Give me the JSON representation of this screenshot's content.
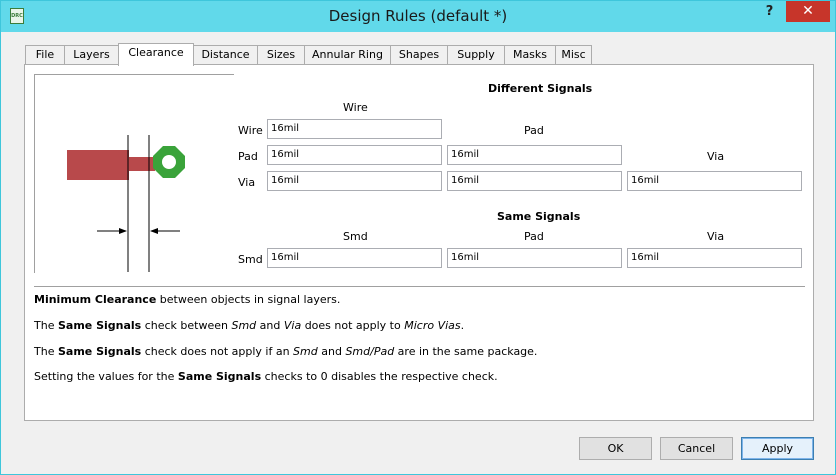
{
  "window": {
    "title": "Design Rules (default *)",
    "app_icon_text": "DRC",
    "help": "?",
    "close": "✕"
  },
  "tabs": [
    "File",
    "Layers",
    "Clearance",
    "Distance",
    "Sizes",
    "Annular Ring",
    "Shapes",
    "Supply",
    "Masks",
    "Misc"
  ],
  "active_tab": "Clearance",
  "colors": {
    "trace": "#b8494b",
    "via": "#3aa33a",
    "close": "#c7352a",
    "titlebar": "#61d9ea"
  },
  "different": {
    "heading": "Different Signals",
    "col_wire": "Wire",
    "col_pad": "Pad",
    "col_via": "Via",
    "row_wire": "Wire",
    "row_pad": "Pad",
    "row_via": "Via",
    "wire_wire": "16mil",
    "pad_wire": "16mil",
    "pad_pad": "16mil",
    "via_wire": "16mil",
    "via_pad": "16mil",
    "via_via": "16mil"
  },
  "same": {
    "heading": "Same Signals",
    "col_smd": "Smd",
    "col_pad": "Pad",
    "col_via": "Via",
    "row_smd": "Smd",
    "smd_smd": "16mil",
    "smd_pad": "16mil",
    "smd_via": "16mil"
  },
  "notes": {
    "n1_b": "Minimum Clearance",
    "n1_r": " between objects in signal layers.",
    "n2_a": "The ",
    "n2_b": "Same Signals",
    "n2_c": " check between ",
    "n2_i1": "Smd",
    "n2_d": " and ",
    "n2_i2": "Via",
    "n2_e": " does not apply to ",
    "n2_i3": "Micro Vias",
    "n2_f": ".",
    "n3_a": "The ",
    "n3_b": "Same Signals",
    "n3_c": " check does not apply if an ",
    "n3_i1": "Smd",
    "n3_d": " and ",
    "n3_i2": "Smd/Pad",
    "n3_e": " are in the same package.",
    "n4_a": "Setting the values for the ",
    "n4_b": "Same Signals",
    "n4_c": " checks to 0 disables the respective check."
  },
  "buttons": {
    "ok": "OK",
    "cancel": "Cancel",
    "apply": "Apply"
  }
}
